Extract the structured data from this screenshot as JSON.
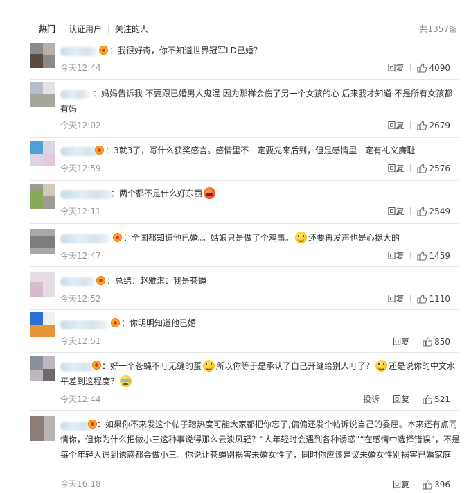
{
  "tabs": {
    "hot": "热门",
    "verified": "认证用户",
    "following": "关注的人",
    "total": "共1357条"
  },
  "actions": {
    "reply": "回复",
    "report": "投诉"
  },
  "comments": [
    {
      "text": "：我很好奇，你不知道世界冠军LD已婚？",
      "time": "今天12:44",
      "likes": "4090"
    },
    {
      "text": "：妈妈告诉我 不要跟已婚男人鬼混 因为那样会伤了另一个女孩的心 后来我才知道 不是所有女孩都有妈",
      "time": "今天12:02",
      "likes": "2679"
    },
    {
      "text": "：3就3了，写什么获奖感言。感情里不一定要先来后到，但是感情里一定有礼义廉耻",
      "time": "今天12:59",
      "likes": "2576"
    },
    {
      "text": "：两个都不是什么好东西",
      "time": "今天12:11",
      "likes": "2549"
    },
    {
      "text_a": "：全国都知道他已婚。。姑娘只是做了个鸡事。",
      "text_b": "还要再发声也是心挺大的",
      "time": "今天12:47",
      "likes": "1459"
    },
    {
      "text": "：总结：赵雅淇：我是苍蝇",
      "time": "今天12:52",
      "likes": "1110"
    },
    {
      "text": "：你明明知道他已婚",
      "time": "今天12:51",
      "likes": "850"
    },
    {
      "text_a": "：好一个苍蝇不叮无缝的蛋",
      "text_b": "所以你等于是承认了自己开缝给别人叮了？",
      "text_c": "还是说你的中文水",
      "text_d": "平差到这程度？",
      "time": "今天12:44",
      "likes": "521"
    },
    {
      "text": "：如果你不来发这个帖子蹭热度可能大家都把你忘了,偏偏还发个帖诉说自己的委屈。本来还有点同情你，但你为什么把做小三这种事说得那么云淡风轻？“人年轻时会遇到各种诱惑”“在感情中选择错误”，不是每个年轻人遇到诱惑都会做小三。你说让苍蝇别祸害未婚女性了，同时你应该建议未婚女性别祸害已婚家庭",
      "time": "今天16:18",
      "likes": "396"
    }
  ],
  "colors": {
    "accent": "#eb7350",
    "muted": "#999999",
    "divider": "#e6e6e6"
  },
  "icons": [
    "thumb-up-icon",
    "vip-badge-icon",
    "smile-emoji-icon",
    "angry-emoji-icon",
    "cry-emoji-icon"
  ]
}
